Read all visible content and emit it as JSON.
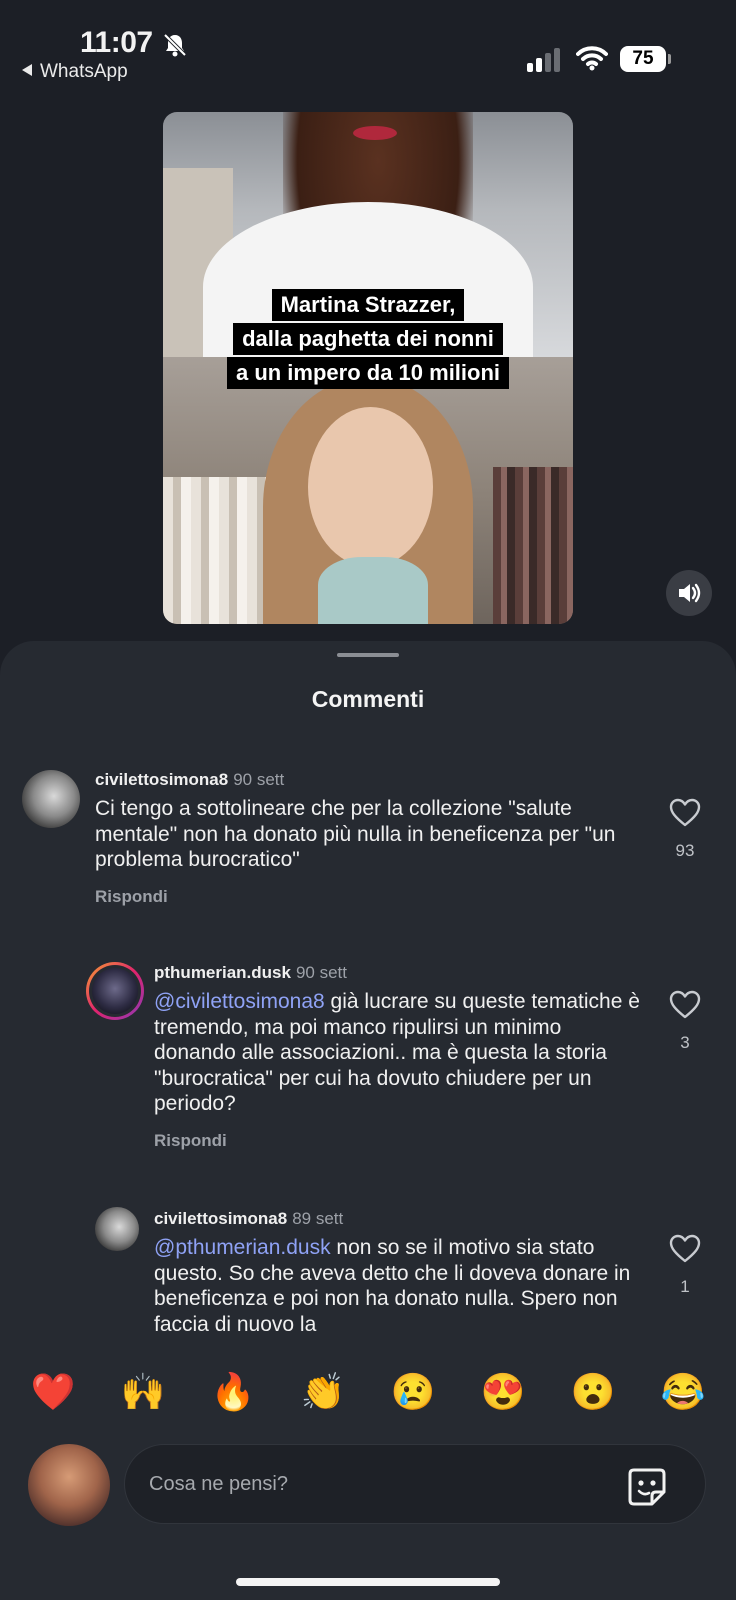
{
  "status_bar": {
    "time": "11:07",
    "back_app": "WhatsApp",
    "battery": "75",
    "icons": [
      "bell-slash-icon",
      "signal-icon",
      "wifi-icon",
      "battery-icon"
    ]
  },
  "video": {
    "caption_lines": [
      "Martina Strazzer,",
      "dalla paghetta dei nonni",
      "a un impero da 10 milioni"
    ]
  },
  "sheet": {
    "title": "Commenti"
  },
  "comments": [
    {
      "username": "civilettosimona8",
      "time": "90 sett",
      "mention": "",
      "text": "Ci tengo a sottolineare che per la collezione \"salute mentale\" non ha donato più nulla in beneficenza per \"un problema burocratico\"",
      "likes": "93",
      "reply_label": "Rispondi"
    },
    {
      "username": "pthumerian.dusk",
      "time": "90 sett",
      "mention": "@civilettosimona8",
      "text": " già lucrare su queste tematiche è tremendo, ma poi manco ripulirsi un minimo donando alle associazioni.. ma è questa la storia \"burocratica\" per cui ha dovuto chiudere per un periodo?",
      "likes": "3",
      "reply_label": "Rispondi"
    },
    {
      "username": "civilettosimona8",
      "time": "89 sett",
      "mention": "@pthumerian.dusk",
      "text": " non so se il motivo sia stato questo. So che aveva detto che li doveva donare in beneficenza e poi non ha donato nulla. Spero non faccia di nuovo la",
      "likes": "1",
      "reply_label": ""
    }
  ],
  "reactions": [
    "❤️",
    "🙌",
    "🔥",
    "👏",
    "😢",
    "😍",
    "😮",
    "😂"
  ],
  "composer": {
    "placeholder": "Cosa ne pensi?"
  },
  "colors": {
    "background": "#1c1f26",
    "sheet": "#262a31",
    "mention": "#8fa2f5"
  }
}
